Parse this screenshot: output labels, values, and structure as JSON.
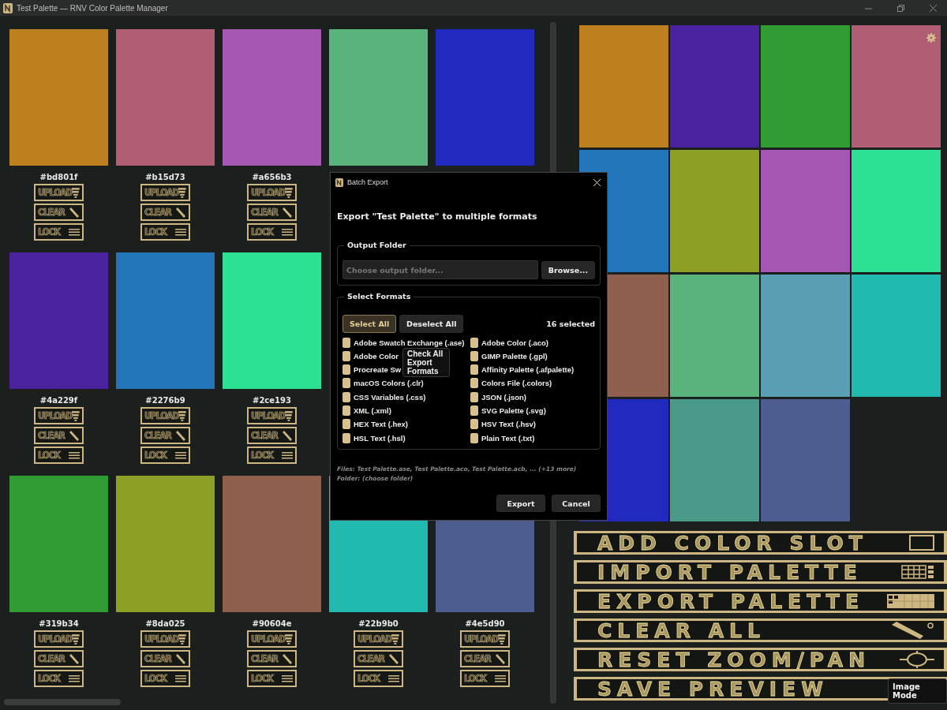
{
  "window": {
    "title": "Test Palette — RNV Color Palette Manager"
  },
  "slots": [
    {
      "kind": "swatch",
      "color": "#bd801f",
      "hex": "#bd801f",
      "buttons": [
        "UPLOAD",
        "CLEAR",
        "LOCK"
      ]
    },
    {
      "kind": "swatch",
      "color": "#b15d73",
      "hex": "#b15d73",
      "buttons": [
        "UPLOAD",
        "CLEAR",
        "LOCK"
      ]
    },
    {
      "kind": "swatch",
      "color": "#a656b3",
      "hex": "#a656b3",
      "buttons": [
        "UPLOAD",
        "CLEAR",
        "LOCK"
      ]
    },
    {
      "kind": "swatch",
      "color": "#5ab37a"
    },
    {
      "kind": "swatch",
      "color": "#2229bf"
    },
    {
      "kind": "swatch",
      "color": "#4a229f",
      "hex": "#4a229f",
      "buttons": [
        "UPLOAD",
        "CLEAR",
        "LOCK"
      ]
    },
    {
      "kind": "swatch",
      "color": "#2276b9",
      "hex": "#2276b9",
      "buttons": [
        "UPLOAD",
        "CLEAR",
        "LOCK"
      ]
    },
    {
      "kind": "swatch",
      "color": "#2ce193",
      "hex": "#2ce193",
      "buttons": [
        "UPLOAD",
        "CLEAR",
        "LOCK"
      ]
    },
    {
      "kind": "hidden"
    },
    {
      "kind": "hidden"
    },
    {
      "kind": "swatch",
      "color": "#319b34",
      "hex": "#319b34",
      "buttons": [
        "UPLOAD",
        "CLEAR",
        "LOCK"
      ]
    },
    {
      "kind": "swatch",
      "color": "#8da025",
      "hex": "#8da025",
      "buttons": [
        "UPLOAD",
        "CLEAR",
        "LOCK"
      ]
    },
    {
      "kind": "swatch",
      "color": "#90604e",
      "hex": "#90604e",
      "buttons": [
        "UPLOAD",
        "CLEAR",
        "LOCK"
      ]
    },
    {
      "kind": "swatch",
      "color": "#22b9b0",
      "hex": "#22b9b0",
      "buttons": [
        "UPLOAD",
        "CLEAR",
        "LOCK"
      ]
    },
    {
      "kind": "swatch",
      "color": "#4e5d90",
      "hex": "#4e5d90",
      "buttons": [
        "UPLOAD",
        "CLEAR",
        "LOCK"
      ]
    }
  ],
  "preview": [
    {
      "color": "#bd801f"
    },
    {
      "color": "#4a229f"
    },
    {
      "color": "#319b34"
    },
    {
      "color": "#b15d73"
    },
    {
      "color": "#2276b9"
    },
    {
      "color": "#8da025"
    },
    {
      "color": "#a656b3"
    },
    {
      "color": "#2ce193"
    },
    {
      "color": "#90604e"
    },
    {
      "color": "#5ab37a"
    },
    {
      "color": "#5a9fb3"
    },
    {
      "color": "#22b9b0"
    },
    {
      "color": "#2229bf"
    },
    {
      "color": "#4a9a8a"
    },
    {
      "color": "#4e5d90"
    }
  ],
  "actions": [
    "ADD COLOR SLOT",
    "IMPORT PALETTE",
    "EXPORT PALETTE",
    "CLEAR ALL",
    "RESET ZOOM/PAN",
    "SAVE PREVIEW"
  ],
  "image_mode_tooltip": "Image Mode",
  "dialog": {
    "title": "Batch Export",
    "heading": "Export \"Test Palette\" to multiple formats",
    "output_group": "Output Folder",
    "folder_placeholder": "Choose output folder...",
    "browse": "Browse...",
    "formats_group": "Select Formats",
    "select_all": {
      "label": "Select All",
      "selected": true
    },
    "deselect_all": {
      "label": "Deselect All",
      "selected": false
    },
    "count": "16 selected",
    "formats": [
      {
        "label": "Adobe Swatch Exchange (.ase)",
        "checked": true
      },
      {
        "label": "Adobe Color (.aco)",
        "checked": true
      },
      {
        "label": "Adobe Color",
        "checked": true
      },
      {
        "label": "GIMP Palette (.gpl)",
        "checked": true
      },
      {
        "label": "Procreate Sw",
        "checked": true
      },
      {
        "label": "Affinity Palette (.afpalette)",
        "checked": true
      },
      {
        "label": "macOS Colors (.clr)",
        "checked": true
      },
      {
        "label": "Colors File (.colors)",
        "checked": true
      },
      {
        "label": "CSS Variables (.css)",
        "checked": true
      },
      {
        "label": "JSON (.json)",
        "checked": true
      },
      {
        "label": "XML (.xml)",
        "checked": true
      },
      {
        "label": "SVG Palette (.svg)",
        "checked": true
      },
      {
        "label": "HEX Text (.hex)",
        "checked": true
      },
      {
        "label": "HSV Text (.hsv)",
        "checked": true
      },
      {
        "label": "HSL Text (.hsl)",
        "checked": true
      },
      {
        "label": "Plain Text (.txt)",
        "checked": true
      }
    ],
    "tooltip": "Check All Export Formats",
    "files": "Files: Test Palette.ase, Test Palette.aco, Test Palette.acb, ... (+13 more)",
    "folder": "Folder: (choose folder)",
    "buttons": [
      "Export",
      "Cancel"
    ]
  }
}
